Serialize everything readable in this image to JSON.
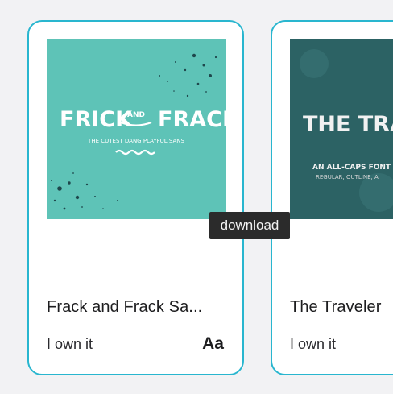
{
  "cards": [
    {
      "title": "Frack and Frack Sa...",
      "ownership": "I own it",
      "preview_glyph": "Aa",
      "thumbnail": {
        "background": "#5ec3b7",
        "headline_left": "FRICK",
        "headline_and": "AND",
        "headline_right": "FRACK",
        "tagline": "THE CUTEST DANG PLAYFUL SANS"
      }
    },
    {
      "title": "The Traveler",
      "ownership": "I own it",
      "thumbnail": {
        "background": "#2c6264",
        "headline": "THE TRAV",
        "tagline": "AN ALL-CAPS FONT WITH",
        "styles": "REGULAR, OUTLINE, A"
      }
    }
  ],
  "tooltip": {
    "text": "download"
  },
  "colors": {
    "card_border": "#29b6cf",
    "tooltip_bg": "#2b2b2b"
  }
}
